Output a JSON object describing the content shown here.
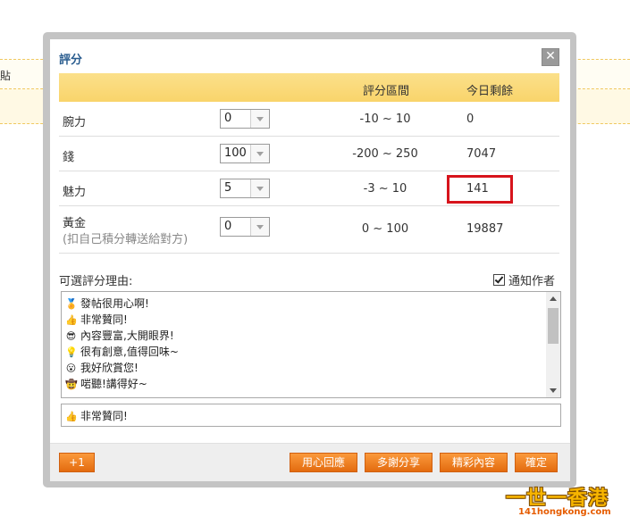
{
  "background": {
    "page_text": "貼"
  },
  "dialog": {
    "title": "評分",
    "close_symbol": "✕",
    "headers": {
      "range": "評分區間",
      "remaining": "今日剩餘"
    },
    "rows": [
      {
        "label": "腕力",
        "value": "0",
        "range": "-10 ~ 10",
        "remaining": "0"
      },
      {
        "label": "錢",
        "value": "100",
        "range": "-200 ~ 250",
        "remaining": "7047"
      },
      {
        "label": "魅力",
        "value": "5",
        "range": "-3 ~ 10",
        "remaining": "141"
      },
      {
        "label": "黃金",
        "note": "(扣自己積分轉送給對方)",
        "value": "0",
        "range": "0 ~ 100",
        "remaining": "19887"
      }
    ],
    "reasons_label": "可選評分理由:",
    "notify_label": "通知作者",
    "notify_checked": true,
    "reasons": [
      {
        "icon": "medal-icon",
        "glyph": "🏅",
        "text": "發帖很用心啊!"
      },
      {
        "icon": "thumbs-up-icon",
        "glyph": "👍",
        "text": "非常贊同!"
      },
      {
        "icon": "sunglasses-face-icon",
        "glyph": "😎",
        "text": "內容豐富,大開眼界!"
      },
      {
        "icon": "lightbulb-icon",
        "glyph": "💡",
        "text": "很有創意,值得回味~"
      },
      {
        "icon": "surprised-face-icon",
        "glyph": "😮",
        "text": "我好欣賞您!"
      },
      {
        "icon": "cowboy-face-icon",
        "glyph": "🤠",
        "text": "啱聽!講得好~"
      }
    ],
    "selected_reason": {
      "icon": "thumbs-up-icon",
      "glyph": "👍",
      "text": "非常贊同!"
    },
    "buttons": {
      "plus_one": "+1",
      "thoughtful": "用心回應",
      "thanks_share": "多謝分享",
      "great_content": "精彩內容",
      "confirm": "確定"
    }
  },
  "watermark": {
    "main": "一世一香港",
    "url": "141hongkong.com"
  },
  "colors": {
    "accent_orange": "#e36b0f",
    "header_yellow": "#f9d46b",
    "highlight_red": "#d7141c",
    "title_blue": "#2a5d8f"
  }
}
